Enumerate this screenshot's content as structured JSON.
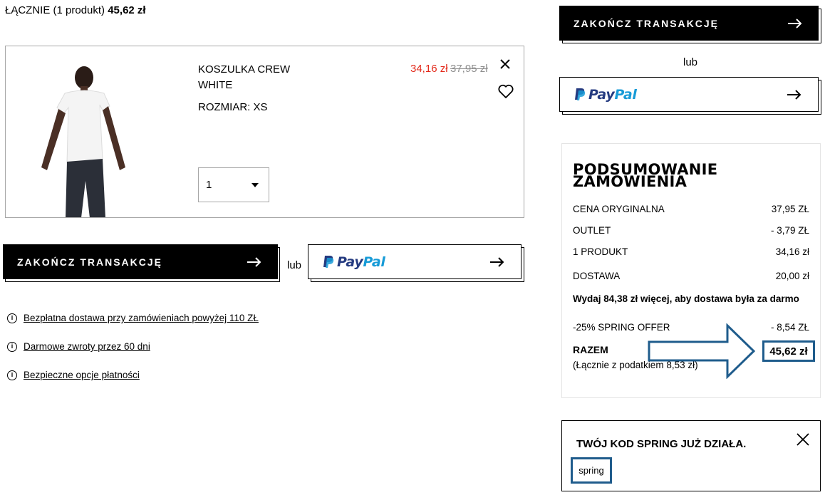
{
  "header": {
    "total_label": "ŁĄCZNIE (1 produkt)",
    "total_value": "45,62 zł"
  },
  "product": {
    "image_icon": "tshirt-model-image",
    "name": "KOSZULKA CREW WHITE",
    "size": "ROZMIAR: XS",
    "price_sale": "34,16 zł",
    "price_original": "37,95 zł",
    "quantity": "1",
    "sale_color": "#e3291a"
  },
  "checkout": {
    "button_label": "ZAKOŃCZ TRANSAKCJĘ",
    "or_label": "lub",
    "paypal_pay": "Pay",
    "paypal_pal": "Pal"
  },
  "info": {
    "items": [
      {
        "text": "Bezpłatna dostawa przy zamówieniach powyżej 110 ZŁ"
      },
      {
        "text": "Darmowe zwroty przez 60 dni"
      },
      {
        "text": "Bezpieczne opcje płatności"
      }
    ]
  },
  "summary": {
    "title": "PODSUMOWANIE ZAMÓWIENIA",
    "rows": [
      {
        "label": "CENA ORYGINALNA",
        "value": "37,95 ZŁ"
      },
      {
        "label": "OUTLET",
        "value": "- 3,79 ZŁ"
      },
      {
        "label": "1 PRODUKT",
        "value": "34,16 zł"
      },
      {
        "label": "DOSTAWA",
        "value": "20,00 zł"
      }
    ],
    "shipping_note": "Wydaj 84,38 zł więcej, aby dostawa była za darmo",
    "discount": {
      "label": "-25% SPRING OFFER",
      "value": "- 8,54 ZŁ"
    },
    "total_label": "RAZEM",
    "tax_note": "(Łącznie z podatkiem  8,53 zł)",
    "total_value": "45,62 zł",
    "highlight_color": "#1f5c8c"
  },
  "promo": {
    "title": "TWÓJ KOD SPRING JUŻ DZIAŁA.",
    "code": "spring"
  }
}
